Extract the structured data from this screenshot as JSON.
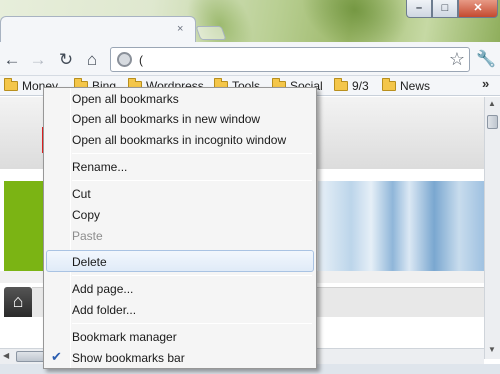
{
  "tab": {
    "close": "×"
  },
  "window_controls": {
    "minimize": "–",
    "maximize": "□",
    "close": "✕"
  },
  "toolbar": {
    "url": "("
  },
  "bookmarks_bar": {
    "items": [
      {
        "label": "Money"
      },
      {
        "label": "Bing"
      },
      {
        "label": "Wordpress"
      },
      {
        "label": "Tools"
      },
      {
        "label": "Social"
      },
      {
        "label": "9/3"
      },
      {
        "label": "News"
      }
    ],
    "more": "»"
  },
  "context_menu": {
    "items": [
      {
        "label": "Open all bookmarks"
      },
      {
        "label": "Open all bookmarks in new window"
      },
      {
        "label": "Open all bookmarks in incognito window"
      },
      {
        "label": "Rename..."
      },
      {
        "label": "Cut"
      },
      {
        "label": "Copy"
      },
      {
        "label": "Paste"
      },
      {
        "label": "Delete"
      },
      {
        "label": "Add page..."
      },
      {
        "label": "Add folder..."
      },
      {
        "label": "Bookmark manager"
      },
      {
        "label": "Show bookmarks bar"
      }
    ]
  },
  "colors": {
    "menu_highlight": "#e0ebf8",
    "check": "#2a5db0"
  }
}
